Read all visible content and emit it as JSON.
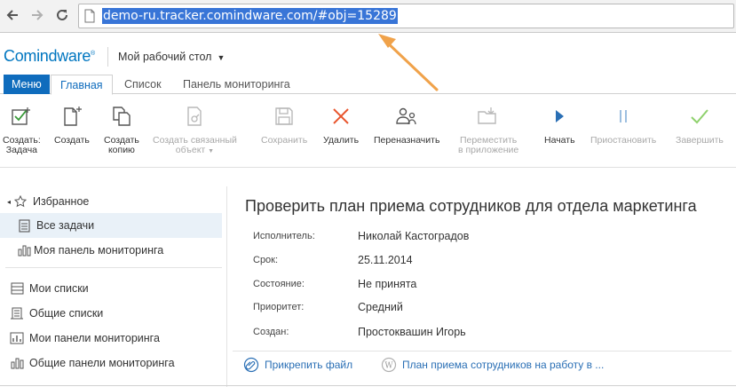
{
  "browser": {
    "url": "demo-ru.tracker.comindware.com/#obj=15289"
  },
  "header": {
    "logo_text": "Comindware",
    "logo_mark": "®",
    "workspace": "Мой рабочий стол"
  },
  "tabs": {
    "menu_label": "Меню",
    "items": [
      {
        "label": "Главная"
      },
      {
        "label": "Список"
      },
      {
        "label": "Панель мониторинга"
      }
    ]
  },
  "toolbar": {
    "items": [
      {
        "line1": "Создать:",
        "line2": "Задача",
        "enabled": true,
        "icon": "create-task-icon"
      },
      {
        "line1": "Создать",
        "line2": "",
        "enabled": true,
        "icon": "create-icon"
      },
      {
        "line1": "Создать",
        "line2": "копию",
        "enabled": true,
        "icon": "copy-icon"
      },
      {
        "line1": "Создать связанный",
        "line2": "объект",
        "enabled": false,
        "icon": "linked-object-icon"
      },
      {
        "line1": "Сохранить",
        "line2": "",
        "enabled": false,
        "icon": "save-icon"
      },
      {
        "line1": "Удалить",
        "line2": "",
        "enabled": true,
        "icon": "delete-icon"
      },
      {
        "line1": "Переназначить",
        "line2": "",
        "enabled": true,
        "icon": "reassign-icon"
      },
      {
        "line1": "Переместить",
        "line2": "в приложение",
        "enabled": false,
        "icon": "move-icon"
      },
      {
        "line1": "Начать",
        "line2": "",
        "enabled": true,
        "icon": "play-icon"
      },
      {
        "line1": "Приостановить",
        "line2": "",
        "enabled": false,
        "icon": "pause-icon"
      },
      {
        "line1": "Завершить",
        "line2": "",
        "enabled": false,
        "icon": "check-icon"
      }
    ]
  },
  "sidebar": {
    "favorites": "Избранное",
    "all_tasks": "Все задачи",
    "my_dashboard": "Моя панель мониторинга",
    "my_lists": "Мои списки",
    "shared_lists": "Общие списки",
    "my_dashboards": "Мои панели мониторинга",
    "shared_dashboards": "Общие панели мониторинга"
  },
  "task": {
    "title": "Проверить план приема сотрудников для отдела маркетинга",
    "fields": [
      {
        "label": "Исполнитель:",
        "value": "Николай Кастоградов"
      },
      {
        "label": "Срок:",
        "value": "25.11.2014"
      },
      {
        "label": "Состояние:",
        "value": "Не принята"
      },
      {
        "label": "Приоритет:",
        "value": "Средний"
      },
      {
        "label": "Создан:",
        "value": "Простоквашин Игорь"
      }
    ],
    "attach_label": "Прикрепить файл",
    "document_link": "План приема сотрудников на работу в ..."
  },
  "colors": {
    "brand": "#0076c0",
    "menu": "#0f6cbd",
    "delete": "#e8552d",
    "play": "#2a6fb5",
    "disabled": "#a8a8a8",
    "complete": "#8fd16d",
    "annotation_arrow": "#f0a24a",
    "url_highlight": "#3875d7"
  }
}
